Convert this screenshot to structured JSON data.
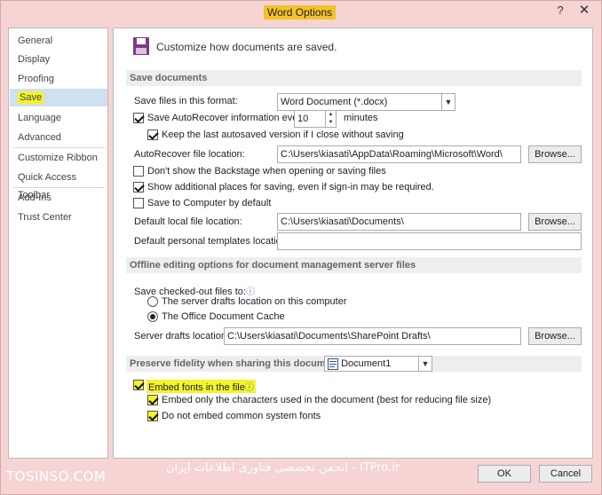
{
  "window": {
    "title": "Word Options",
    "help_icon": "?",
    "close_icon": "✕"
  },
  "sidebar": {
    "items": [
      {
        "label": "General"
      },
      {
        "label": "Display"
      },
      {
        "label": "Proofing"
      },
      {
        "label": "Save",
        "selected": true
      },
      {
        "label": "Language"
      },
      {
        "label": "Advanced"
      },
      {
        "label": "Customize Ribbon"
      },
      {
        "label": "Quick Access Toolbar"
      },
      {
        "label": "Add-Ins"
      },
      {
        "label": "Trust Center"
      }
    ]
  },
  "header": {
    "text": "Customize how documents are saved.",
    "icon": "save-icon"
  },
  "save_documents": {
    "section_title": "Save documents",
    "format_label": "Save files in this format:",
    "format_value": "Word Document (*.docx)",
    "autorecover_label": "Save AutoRecover information every",
    "autorecover_checked": true,
    "autorecover_minutes": "10",
    "minutes_label": "minutes",
    "keep_last_label": "Keep the last autosaved version if I close without saving",
    "keep_last_checked": true,
    "autorecover_location_label": "AutoRecover file location:",
    "autorecover_location_value": "C:\\Users\\kiasati\\AppData\\Roaming\\Microsoft\\Word\\",
    "browse_label": "Browse...",
    "backstage_label": "Don't show the Backstage when opening or saving files",
    "backstage_checked": false,
    "additional_places_label": "Show additional places for saving, even if sign-in may be required.",
    "additional_places_checked": true,
    "save_to_computer_label": "Save to Computer by default",
    "save_to_computer_checked": false,
    "default_local_label": "Default local file location:",
    "default_local_value": "C:\\Users\\kiasati\\Documents\\",
    "default_personal_label": "Default personal templates location:",
    "default_personal_value": ""
  },
  "offline": {
    "section_title": "Offline editing options for document management server files",
    "checked_out_label": "Save checked-out files to:",
    "info_icon": "ⓘ",
    "server_drafts_option": "The server drafts location on this computer",
    "office_cache_option": "The Office Document Cache",
    "selected_option": "office_cache",
    "server_drafts_location_label": "Server drafts location:",
    "server_drafts_location_value": "C:\\Users\\kiasati\\Documents\\SharePoint Drafts\\"
  },
  "fidelity": {
    "section_title": "Preserve fidelity when sharing this document:",
    "document_value": "Document1",
    "embed_fonts_label": "Embed fonts in the file",
    "embed_fonts_checked": true,
    "embed_only_label": "Embed only the characters used in the document (best for reducing file size)",
    "embed_only_checked": true,
    "do_not_embed_label": "Do not embed common system fonts",
    "do_not_embed_checked": true
  },
  "footer": {
    "watermark_left": "TOSINSO.COM",
    "watermark_mid": "انجمن تخصصی فناوری اطلاعات ایران - ITPro.ir",
    "ok_label": "OK",
    "cancel_label": "Cancel"
  },
  "colors": {
    "highlight": "#f5f32a",
    "title_highlight": "#f3c228",
    "selected_nav": "#cfe0f1"
  }
}
